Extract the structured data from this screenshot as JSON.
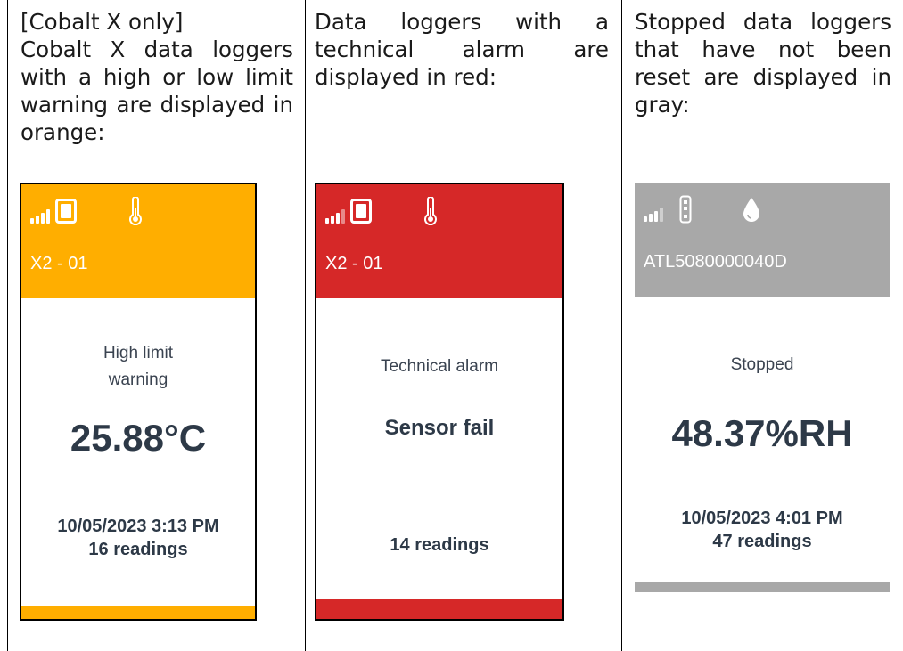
{
  "columns": [
    {
      "description_lines": [
        "[Cobalt X only]",
        "Cobalt X data loggers with a high or low limit warning are displayed in orange:"
      ],
      "header_color": "#FFAE00",
      "footer_color": "#FFAE00",
      "icons": [
        "signal-icon",
        "battery-icon",
        "thermometer-icon"
      ],
      "device_id": "X2 - 01",
      "status_line1": "High limit",
      "status_line2": "warning",
      "value": "25.88°C",
      "timestamp": "10/05/2023 3:13 PM",
      "readings": "16 readings"
    },
    {
      "description_lines": [
        "Data loggers with a technical alarm are displayed in red:"
      ],
      "header_color": "#D62828",
      "footer_color": "#D62828",
      "icons": [
        "signal-icon",
        "battery-icon",
        "thermometer-icon"
      ],
      "device_id": "X2 - 01",
      "status_line1": "Technical alarm",
      "message": "Sensor fail",
      "readings": "14 readings"
    },
    {
      "description_lines": [
        "Stopped data loggers that have not been reset are displayed in gray:"
      ],
      "header_color": "#A8A8A8",
      "footer_color": "#A8A8A8",
      "icons": [
        "signal-icon",
        "battery-icon",
        "humidity-drop-icon"
      ],
      "device_id": "ATL5080000040D",
      "status_line1": "Stopped",
      "value": "48.37%RH",
      "timestamp": "10/05/2023 4:01 PM",
      "readings": "47 readings"
    }
  ]
}
